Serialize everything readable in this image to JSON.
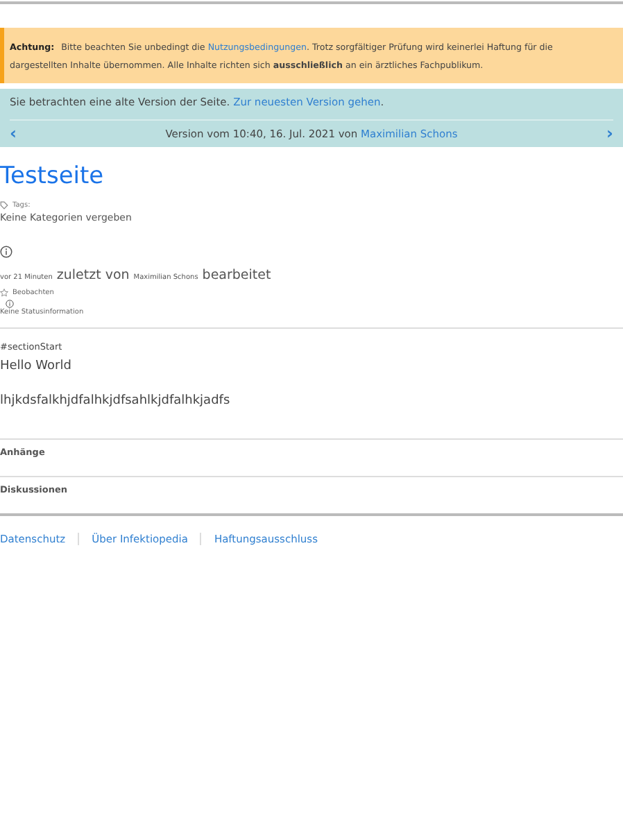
{
  "notice": {
    "label": "Achtung:",
    "text_before": "Bitte beachten Sie unbedingt die ",
    "link": "Nutzungsbedingungen",
    "text_after": ". Trotz sorgfältiger Prüfung wird keinerlei Haftung für die dargestellten Inhalte übernommen. Alle Inhalte richten sich **ausschließlich** an ein ärztliches Fachpublikum."
  },
  "version_box": {
    "text": "Sie betrachten eine alte Version der Seite. ",
    "link": "Zur neuesten Version gehen",
    "link_suffix": ".",
    "prev": "‹",
    "version_text": "Version vom 10:40, 16. Jul. 2021 von ",
    "author": "Maximilian Schons",
    "next": "›"
  },
  "page": {
    "title": "Testseite",
    "tags_label": "Tags:",
    "tags_value": "Keine Kategorien vergeben",
    "edited": [
      {
        "text": "vor 21 Minuten",
        "kind": "small"
      },
      {
        "text": "zuletzt von",
        "kind": "large"
      },
      {
        "text": "Maximilian Schons",
        "kind": "small"
      },
      {
        "text": "bearbeitet",
        "kind": "large"
      }
    ],
    "watch": "Beobachten",
    "status": "Keine Statusinformation"
  },
  "content": {
    "anchor": "#sectionStart",
    "heading": "Hello World",
    "paragraph": "lhjkdsfalkhjdfalhkjdfsahlkjdfalhkjadfs"
  },
  "sections": [
    "Anhänge",
    "Diskussionen"
  ],
  "footer_links": [
    "Datenschutz",
    "Über Infektiopedia",
    "Haftungsausschluss"
  ]
}
